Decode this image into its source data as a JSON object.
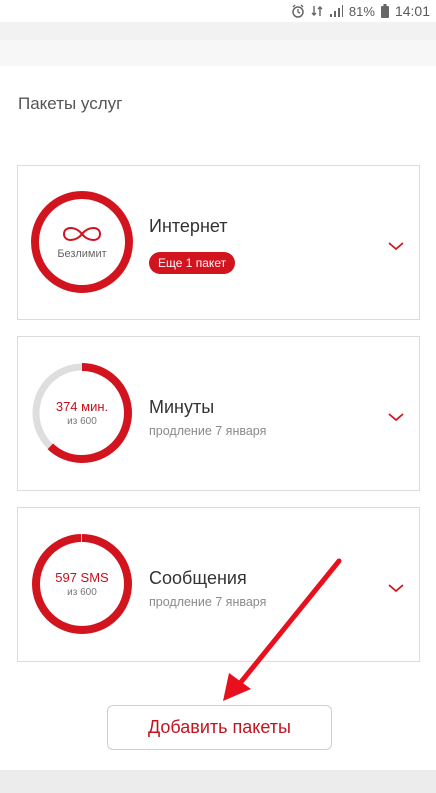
{
  "status_bar": {
    "battery": "81%",
    "time": "14:01",
    "icons": [
      "alarm-icon",
      "data-sync-icon",
      "signal-icon",
      "battery-icon"
    ]
  },
  "section_title": "Пакеты услуг",
  "cards": [
    {
      "ring_label": "Безлимит",
      "ring_icon": "infinity-icon",
      "title": "Интернет",
      "badge": "Еще 1 пакет"
    },
    {
      "ring_main": "374 мин.",
      "ring_sub": "из 600",
      "title": "Минуты",
      "subtitle": "продление 7 января",
      "remaining_fraction": 0.62
    },
    {
      "ring_main": "597 SMS",
      "ring_sub": "из 600",
      "title": "Сообщения",
      "subtitle": "продление 7 января",
      "remaining_fraction": 0.995
    }
  ],
  "add_button_label": "Добавить пакеты",
  "colors": {
    "accent": "#d2141f",
    "ring_track": "#dedede"
  }
}
